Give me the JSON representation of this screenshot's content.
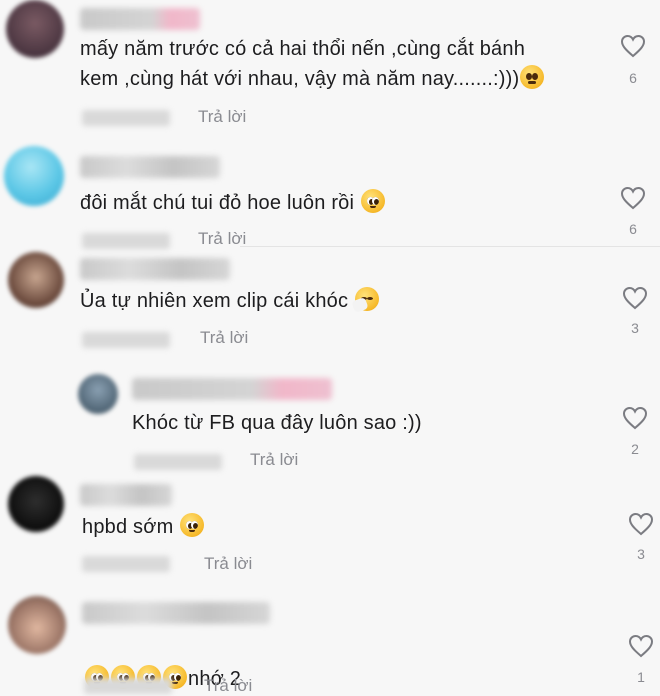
{
  "reply_label": "Trả lời",
  "comments": [
    {
      "text_main": "mấy năm trước có cả hai thổi nến ,cùng cắt bánh\nkem ,cùng hát với nhau, vậy mà năm nay.......:)))",
      "emoji": "slight-frown",
      "likes": "6"
    },
    {
      "text_main": "đôi mắt chú tui đỏ hoe luôn rồi ",
      "emoji": "pleading-face",
      "likes": "6"
    },
    {
      "text_main": "Ủa tự nhiên xem clip cái khóc ",
      "emoji": "sneezing-face",
      "likes": "3"
    },
    {
      "text_main": "Khóc từ FB qua đây luôn sao :))",
      "likes": "2"
    },
    {
      "text_main": "hpbd sớm ",
      "emoji": "pleading-face",
      "likes": "3"
    },
    {
      "text_after": "nhớ 2",
      "emoji": "pleading-face",
      "emoji_count": 4,
      "likes": "1"
    }
  ],
  "colors": {
    "background": "#f7f7f7",
    "muted": "#8a8b91",
    "text": "#1d1d1f"
  }
}
